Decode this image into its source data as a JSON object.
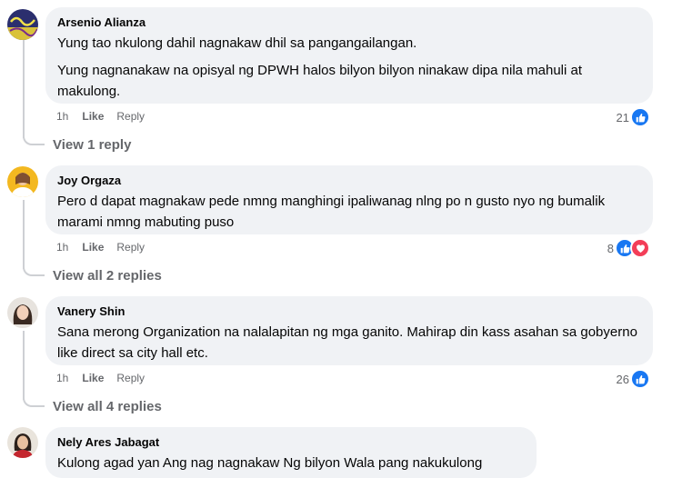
{
  "comments": [
    {
      "author": "Arsenio Alianza",
      "paragraphs": [
        "Yung tao nkulong dahil nagnakaw dhil sa pangangailangan.",
        "Yung nagnanakaw na opisyal ng DPWH halos bilyon bilyon ninakaw dipa nila mahuli at makulong."
      ],
      "time": "1h",
      "like_label": "Like",
      "reply_label": "Reply",
      "reaction_count": "21",
      "reactions": [
        "like"
      ],
      "view_replies": "View 1 reply"
    },
    {
      "author": "Joy Orgaza",
      "paragraphs": [
        "Pero d dapat magnakaw pede nmng manghingi ipaliwanag nlng po n gusto nyo ng bumalik marami nmng mabuting puso"
      ],
      "time": "1h",
      "like_label": "Like",
      "reply_label": "Reply",
      "reaction_count": "8",
      "reactions": [
        "like",
        "love"
      ],
      "view_replies": "View all 2 replies"
    },
    {
      "author": "Vanery Shin",
      "paragraphs": [
        "Sana merong Organization na nalalapitan ng mga ganito. Mahirap din kass asahan sa gobyerno like direct sa city hall etc."
      ],
      "time": "1h",
      "like_label": "Like",
      "reply_label": "Reply",
      "reaction_count": "26",
      "reactions": [
        "like"
      ],
      "view_replies": "View all 4 replies"
    },
    {
      "author": "Nely Ares Jabagat",
      "paragraphs": [
        "Kulong agad yan Ang nag nagnakaw Ng bilyon Wala pang nakukulong"
      ]
    }
  ],
  "colors": {
    "bubble": "#f0f2f5",
    "meta": "#65676b",
    "like_blue": "#1877f2",
    "love_red": "#f33e58",
    "thread_line": "#ced0d4"
  },
  "icons": {
    "like": "thumbs-up-icon",
    "love": "heart-icon"
  }
}
